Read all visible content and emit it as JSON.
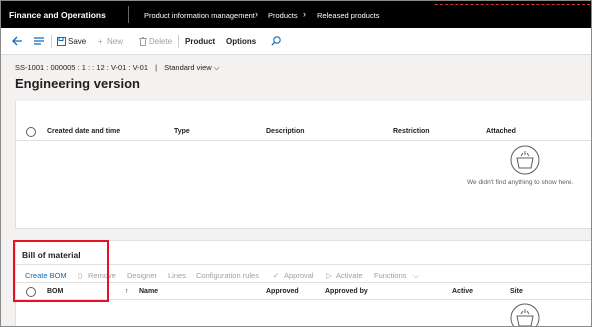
{
  "topbar": {
    "app_title": "Finance and Operations",
    "breadcrumbs": [
      "Product information management",
      "Products",
      "Released products"
    ]
  },
  "actionbar": {
    "save": "Save",
    "new": "New",
    "delete": "Delete",
    "product": "Product",
    "options": "Options"
  },
  "header": {
    "identifier": "SS-1001 : 000005 : 1 : : 12 : V-01 : V-01",
    "view": "Standard view",
    "title": "Engineering version"
  },
  "attachments_grid": {
    "columns": [
      "Created date and time",
      "Type",
      "Description",
      "Restriction",
      "Attached"
    ],
    "empty_message": "We didn't find anything to show here."
  },
  "bom": {
    "title": "Bill of material",
    "toolbar": [
      "Create BOM",
      "Remove",
      "Designer",
      "Lines",
      "Configuration rules",
      "Approval",
      "Activate",
      "Functions"
    ],
    "columns": [
      "BOM",
      "Name",
      "Approved",
      "Approved by",
      "Active",
      "Site"
    ]
  },
  "colors": {
    "topbar": "#000000",
    "accent": "#0f6cbd",
    "highlight": "#e81123"
  }
}
